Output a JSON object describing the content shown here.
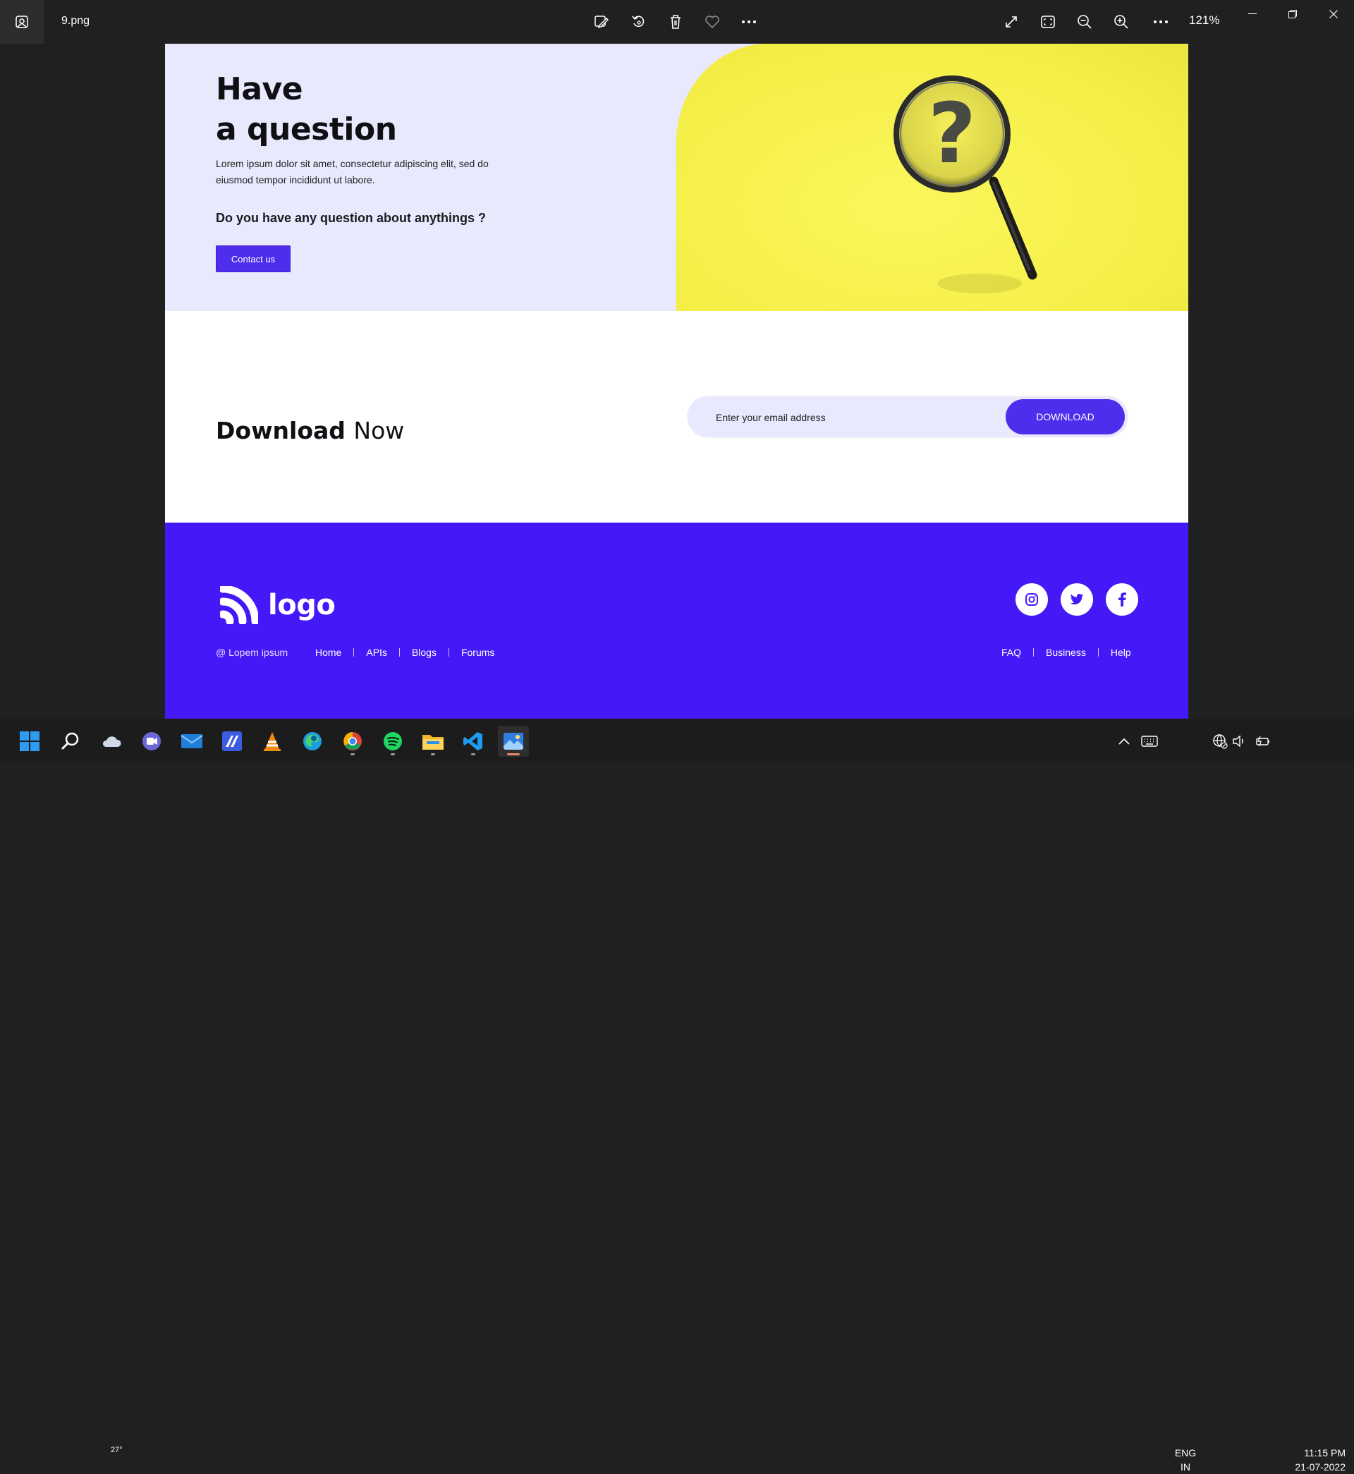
{
  "viewer": {
    "file_name": "9.png",
    "zoom": "121%",
    "icons": {
      "app": "photos-app-icon",
      "edit": "edit-image-icon",
      "rotate": "rotate-icon",
      "delete": "trash-icon",
      "favorite": "heart-icon",
      "more": "more-options-icon",
      "fullscreen": "expand-icon",
      "fit": "fit-to-window-icon",
      "zoom_out": "zoom-out-icon",
      "zoom_in": "zoom-in-icon"
    }
  },
  "hero": {
    "title_line1": "Have",
    "title_line2": "a question",
    "description": "Lorem ipsum dolor sit amet, consectetur adipiscing elit, sed do eiusmod tempor incididunt ut labore.",
    "question": "Do you have any question about anythings ?",
    "contact_label": "Contact us",
    "image": "magnifying-glass-question-mark"
  },
  "download": {
    "title_bold": "Download",
    "title_light": "Now",
    "email_placeholder": "Enter your email address",
    "button_label": "DOWNLOAD"
  },
  "footer": {
    "logo_text": "logo",
    "copyright": "@ Lopem ipsum",
    "nav_left": [
      "Home",
      "APIs",
      "Blogs",
      "Forums"
    ],
    "nav_right": [
      "FAQ",
      "Business",
      "Help"
    ],
    "social": [
      "instagram-icon",
      "twitter-icon",
      "facebook-icon"
    ]
  },
  "taskbar": {
    "weather_temp": "27°",
    "lang_top": "ENG",
    "lang_bottom": "IN",
    "time": "11:15 PM",
    "date": "21-07-2022"
  },
  "colors": {
    "accent": "#4f2dec",
    "footer_bg": "#4519f7",
    "hero_bg": "#e8e9fc",
    "hero_image_yellow": "#f8f356"
  }
}
